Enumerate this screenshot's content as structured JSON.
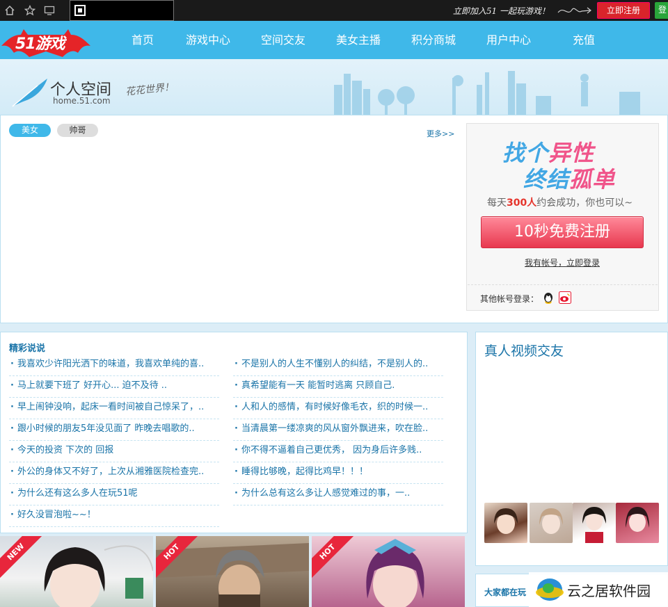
{
  "topbar": {
    "promo": "立即加入51 一起玩游戏！",
    "register": "立即注册",
    "login": "登"
  },
  "nav": {
    "logo": "51游戏",
    "items": [
      "首页",
      "游戏中心",
      "空间交友",
      "美女主播",
      "积分商城",
      "用户中心",
      "充值"
    ]
  },
  "banner": {
    "title": "个人空间",
    "url": "home.51.com",
    "slogan": "花花世界！"
  },
  "tabs": {
    "girls": "美女",
    "guys": "帅哥",
    "more": "更多>>"
  },
  "register_box": {
    "line1_a": "找个",
    "line1_b": "异性",
    "line2_a": "终结",
    "line2_b": "孤单",
    "sub_a": "每天",
    "sub_num": "300人",
    "sub_b": "约会成功，你也可以~",
    "button": "10秒免费注册",
    "login_link": "我有帐号，立即登录",
    "other_login": "其他帐号登录："
  },
  "posts": {
    "title": "精彩说说",
    "left": [
      "我喜欢少许阳光洒下的味道，我喜欢单纯的喜..",
      "马上就要下班了 好开心... 迫不及待 ..",
      "早上闹钟没响，起床一看时间被自己惊呆了，..",
      "跟小时候的朋友5年没见面了 昨晚去唱歌的..",
      "今天的投资  下次的 回报",
      "外公的身体又不好了，上次从湘雅医院检查完..",
      "为什么还有这么多人在玩51呢",
      "好久没冒泡啦~~！"
    ],
    "right": [
      "不是别人的人生不懂别人的纠结，不是别人的..",
      "真希望能有一天 能暂时逃离 只顾自己.",
      "人和人的感情，有时候好像毛衣，织的时候一..",
      "当清晨第一缕凉爽的风从窗外飘进来，吹在脸..",
      "你不得不逼着自己更优秀， 因为身后许多贱..",
      "睡得比够晚，起得比鸡早！！！",
      " 为什么总有这么多让人感觉难过的事，一.."
    ]
  },
  "video": {
    "title": "真人视频交友"
  },
  "bottom_panel": {
    "title": "大家都在玩"
  },
  "thumbs": {
    "badge1": "NEW",
    "badge2": "HOT",
    "badge3": "HOT"
  },
  "watermark": {
    "text": "云之居软件园"
  }
}
